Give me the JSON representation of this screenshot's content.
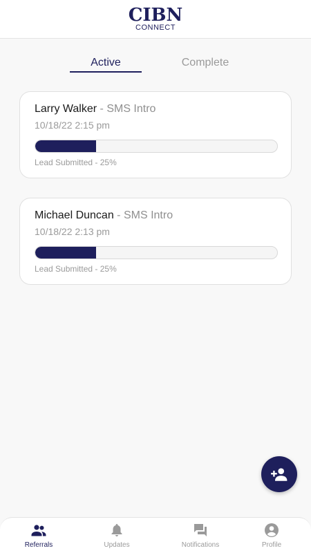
{
  "header": {
    "logo_main": "CIBN",
    "logo_sub": "CONNECT"
  },
  "tabs": [
    {
      "label": "Active",
      "active": true
    },
    {
      "label": "Complete",
      "active": false
    }
  ],
  "referrals": [
    {
      "name": "Larry Walker",
      "separator": " - ",
      "type": "SMS Intro",
      "date": "10/18/22 2:15 pm",
      "progress": 0.25,
      "status": "Lead Submitted - 25%"
    },
    {
      "name": "Michael Duncan",
      "separator": " - ",
      "type": "SMS Intro",
      "date": "10/18/22 2:13 pm",
      "progress": 0.25,
      "status": "Lead Submitted - 25%"
    }
  ],
  "fab": {
    "icon": "add-person-icon"
  },
  "nav": [
    {
      "label": "Referrals",
      "icon": "people-icon",
      "active": true
    },
    {
      "label": "Updates",
      "icon": "bell-icon",
      "active": false
    },
    {
      "label": "Notifications",
      "icon": "chat-icon",
      "active": false
    },
    {
      "label": "Profile",
      "icon": "account-circle-icon",
      "active": false
    }
  ],
  "colors": {
    "brand": "#1e1f5c",
    "muted": "#9a9a9a",
    "background": "#f8f8f8"
  }
}
